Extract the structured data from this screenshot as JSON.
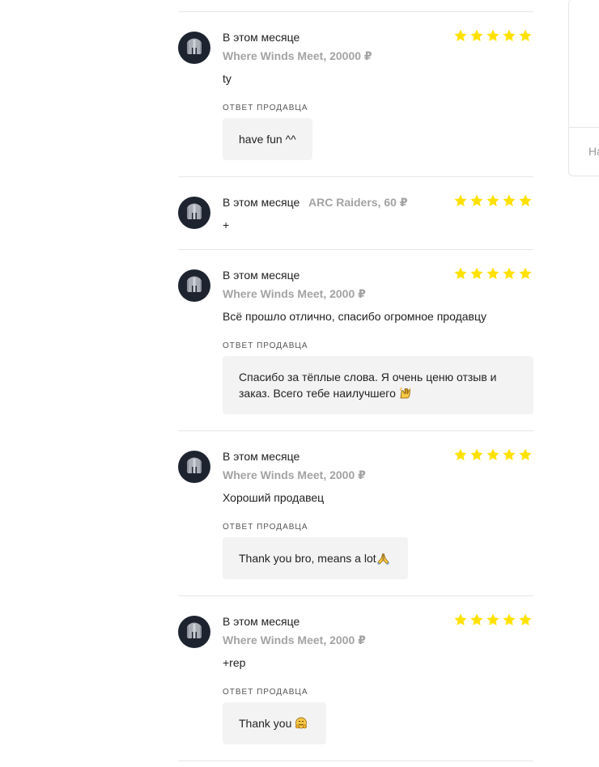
{
  "reviews": [
    {
      "date": "В этом месяце",
      "product": "Where Winds Meet, 20000 ₽",
      "rating": 5,
      "text": "ty",
      "reply_label": "ОТВЕТ ПРОДАВЦА",
      "reply": "have fun ^^"
    },
    {
      "date": "В этом месяце",
      "product": "ARC Raiders, 60 ₽",
      "rating": 5,
      "text": "+"
    },
    {
      "date": "В этом месяце",
      "product": "Where Winds Meet, 2000 ₽",
      "rating": 5,
      "text": "Всё прошло отлично, спасибо огромное продавцу",
      "reply_label": "ОТВЕТ ПРОДАВЦА",
      "reply_line1": "Спасибо за тёплые слова. Я очень ценю отзыв и",
      "reply_line2": "заказ. Всего тебе наилучшего",
      "reply_emoji": "raising-hands-emoji"
    },
    {
      "date": "В этом месяце",
      "product": "Where Winds Meet, 2000 ₽",
      "rating": 5,
      "text": "Хороший продавец",
      "reply_label": "ОТВЕТ ПРОДАВЦА",
      "reply": "Thank you bro, means a lot",
      "reply_emoji": "folded-hands-emoji"
    },
    {
      "date": "В этом месяце",
      "product": "Where Winds Meet, 2000 ₽",
      "rating": 5,
      "text": "+rep",
      "reply_label": "ОТВЕТ ПРОДАВЦА",
      "reply": "Thank you",
      "reply_emoji": "hugging-face-emoji"
    }
  ],
  "sidebar": {
    "partial_text": "На"
  },
  "colors": {
    "star": "#FFE100",
    "avatar_bg": "#1d2430",
    "reply_bg": "#f3f3f3",
    "product_text": "#a3a3a3",
    "divider": "#e6e6e6"
  },
  "icons": {
    "avatar": "spartan-helmet-icon",
    "star": "star-icon"
  }
}
